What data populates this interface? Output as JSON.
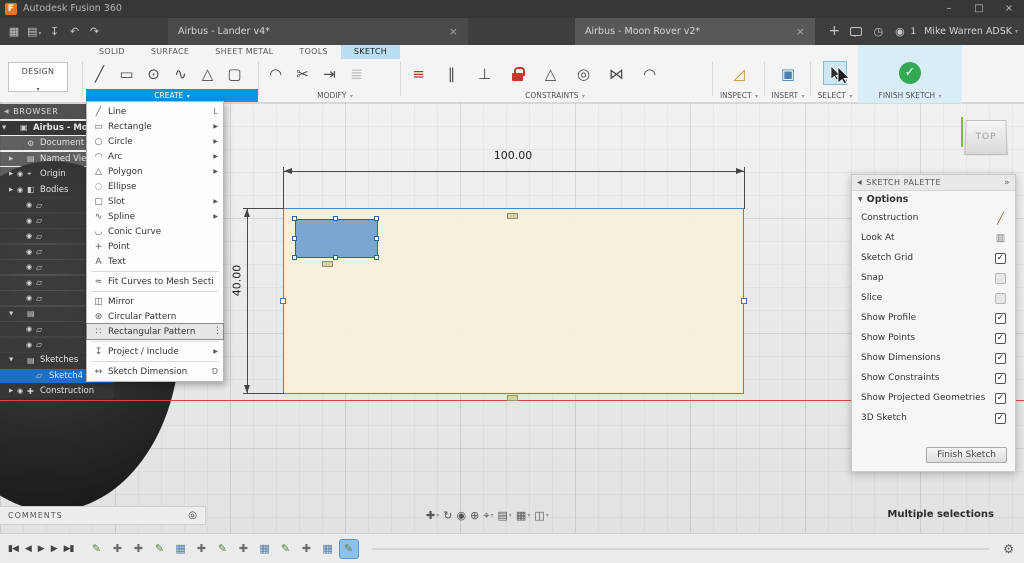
{
  "colors": {
    "accent_blue": "#0a96d7",
    "ribbon_tab_highlight": "#b9e0f1",
    "selection_blue": "#1d6fc2",
    "finish_green": "#35a854",
    "axis_red": "#c94f43",
    "profile_fill": "#f7f0db",
    "selected_geometry": "#5c92d0"
  },
  "titlebar": {
    "app_title": "Autodesk Fusion 360"
  },
  "tabbar": {
    "left_icons": [
      {
        "name": "app-grid-icon",
        "glyph": "▦"
      },
      {
        "name": "file-menu-icon",
        "glyph": "▤",
        "caret": true
      },
      {
        "name": "save-icon",
        "glyph": "↧"
      },
      {
        "name": "undo-icon",
        "glyph": "↶"
      },
      {
        "name": "redo-icon",
        "glyph": "↷"
      }
    ],
    "tabs": [
      {
        "label": "Airbus - Lander v4*"
      },
      {
        "label": "Airbus - Moon Rover v2*",
        "active": true
      }
    ],
    "notification_count": "1",
    "user_name": "Mike Warren ADSK"
  },
  "workspace": {
    "selector_label": "DESIGN"
  },
  "ribbon_tabs": [
    {
      "label": "SOLID"
    },
    {
      "label": "SURFACE"
    },
    {
      "label": "SHEET METAL"
    },
    {
      "label": "TOOLS"
    },
    {
      "label": "SKETCH",
      "active": true
    }
  ],
  "toolbar": {
    "groups": {
      "create": "CREATE",
      "modify": "MODIFY",
      "constraints": "CONSTRAINTS",
      "inspect": "INSPECT",
      "insert": "INSERT",
      "select": "SELECT",
      "finish": "FINISH SKETCH"
    },
    "create_icons": [
      {
        "name": "line-icon",
        "glyph": "╱"
      },
      {
        "name": "rectangle-icon",
        "glyph": "▭"
      },
      {
        "name": "circle-icon",
        "glyph": "⊙"
      },
      {
        "name": "spline-icon",
        "glyph": "∿"
      },
      {
        "name": "polygon-icon",
        "glyph": "△"
      },
      {
        "name": "slot-icon",
        "glyph": "▢"
      }
    ],
    "modify_icons": [
      {
        "name": "fillet-icon",
        "glyph": "◠"
      },
      {
        "name": "trim-icon",
        "glyph": "✂"
      },
      {
        "name": "extend-icon",
        "glyph": "⇥"
      },
      {
        "name": "offset-icon",
        "glyph": "≣",
        "dim": true
      }
    ],
    "constraint_icons": [
      {
        "name": "coincident-icon",
        "glyph": "≡",
        "accent": true,
        "cls": "accent-red"
      },
      {
        "name": "parallel-icon",
        "glyph": "∥"
      },
      {
        "name": "perpendicular-icon",
        "glyph": "⊥"
      },
      {
        "name": "lock-icon",
        "glyph": "",
        "cls": "lockshape"
      },
      {
        "name": "tangent-icon",
        "glyph": "△"
      },
      {
        "name": "concentric-icon",
        "glyph": "◎"
      },
      {
        "name": "symmetry-icon",
        "glyph": "⋈"
      },
      {
        "name": "curvature-icon",
        "glyph": "◠"
      }
    ]
  },
  "create_menu": {
    "items": [
      {
        "label": "Line",
        "glyph": "╱",
        "shortcut": "L"
      },
      {
        "label": "Rectangle",
        "glyph": "▭",
        "submenu": true
      },
      {
        "label": "Circle",
        "glyph": "○",
        "submenu": true
      },
      {
        "label": "Arc",
        "glyph": "◠",
        "submenu": true
      },
      {
        "label": "Polygon",
        "glyph": "△",
        "submenu": true
      },
      {
        "label": "Ellipse",
        "glyph": "◌"
      },
      {
        "label": "Slot",
        "glyph": "▢",
        "submenu": true
      },
      {
        "label": "Spline",
        "glyph": "∿",
        "submenu": true
      },
      {
        "label": "Conic Curve",
        "glyph": "◡"
      },
      {
        "label": "Point",
        "glyph": "+"
      },
      {
        "label": "Text",
        "glyph": "A"
      },
      {
        "label": "Fit Curves to Mesh Section",
        "glyph": "≈",
        "sep": true
      },
      {
        "label": "Mirror",
        "glyph": "◫",
        "sep": true
      },
      {
        "label": "Circular Pattern",
        "glyph": "⊛"
      },
      {
        "label": "Rectangular Pattern",
        "glyph": "∷",
        "highlighted": true
      },
      {
        "label": "Project / Include",
        "glyph": "↧",
        "submenu": true,
        "sep": true
      },
      {
        "label": "Sketch Dimension",
        "glyph": "↔",
        "shortcut": "D",
        "sep": true
      }
    ]
  },
  "browser": {
    "title": "BROWSER",
    "rows": [
      {
        "exp": "▼",
        "glyph": "▣",
        "label": "Airbus - Moon Ro",
        "root": true
      },
      {
        "glyph": "⚙",
        "label": "Document Settings",
        "cls": "ind1"
      },
      {
        "exp": "▶",
        "glyph": "▤",
        "label": "Named Views",
        "cls": "ind1"
      },
      {
        "exp": "▶",
        "eye": true,
        "glyph": "⌖",
        "label": "Origin",
        "cls": "ind1"
      },
      {
        "exp": "▶",
        "eye": true,
        "glyph": "◧",
        "label": "Bodies",
        "cls": "ind1"
      },
      {
        "eye": true,
        "glyph": "▱",
        "label": "",
        "cls": "ind2"
      },
      {
        "eye": true,
        "glyph": "▱",
        "label": "",
        "cls": "ind2"
      },
      {
        "eye": true,
        "glyph": "▱",
        "label": "",
        "cls": "ind2"
      },
      {
        "eye": true,
        "glyph": "▱",
        "label": "",
        "cls": "ind2"
      },
      {
        "eye": true,
        "glyph": "▱",
        "label": "",
        "cls": "ind2"
      },
      {
        "eye": true,
        "glyph": "▱",
        "label": "",
        "cls": "ind2"
      },
      {
        "eye": true,
        "glyph": "▱",
        "label": "",
        "cls": "ind2"
      },
      {
        "exp": "▼",
        "glyph": "▤",
        "label": "",
        "cls": "ind1"
      },
      {
        "eye": true,
        "glyph": "▱",
        "label": "",
        "cls": "ind2"
      },
      {
        "eye": true,
        "glyph": "▱",
        "label": "",
        "cls": "ind2"
      },
      {
        "exp": "▼",
        "glyph": "▤",
        "label": "Sketches",
        "cls": "ind1"
      },
      {
        "glyph": "▱",
        "label": "Sketch4",
        "cls": "ind2",
        "selected": true
      },
      {
        "exp": "▶",
        "eye": true,
        "glyph": "✚",
        "label": "Construction",
        "cls": "ind1"
      }
    ]
  },
  "canvas": {
    "dim_width": "100.00",
    "dim_height": "40.00",
    "viewcube_face": "TOP"
  },
  "sketch_palette": {
    "title": "SKETCH PALETTE",
    "section_label": "Options",
    "rows": [
      {
        "label": "Construction",
        "cls": "ctl-construction"
      },
      {
        "label": "Look At",
        "cls": "ctl-lookat"
      },
      {
        "label": "Sketch Grid",
        "checked": true
      },
      {
        "label": "Snap"
      },
      {
        "label": "Slice"
      },
      {
        "label": "Show Profile",
        "checked": true
      },
      {
        "label": "Show Points",
        "checked": true
      },
      {
        "label": "Show Dimensions",
        "checked": true
      },
      {
        "label": "Show Constraints",
        "checked": true
      },
      {
        "label": "Show Projected Geometries",
        "checked": true
      },
      {
        "label": "3D Sketch",
        "checked": true
      }
    ],
    "finish_button_label": "Finish Sketch"
  },
  "statusbar": {
    "comments_label": "COMMENTS",
    "selection_status": "Multiple selections"
  },
  "nav_icons": [
    {
      "name": "pan-icon",
      "glyph": "✚",
      "caret": true
    },
    {
      "name": "orbit-icon",
      "glyph": "↻"
    },
    {
      "name": "look-at-icon",
      "glyph": "◉"
    },
    {
      "name": "zoom-icon",
      "glyph": "⊕"
    },
    {
      "name": "fit-view-icon",
      "glyph": "⌖",
      "caret": true
    },
    {
      "name": "display-settings-icon",
      "glyph": "▤",
      "caret": true
    },
    {
      "name": "grid-settings-icon",
      "glyph": "▦",
      "caret": true
    },
    {
      "name": "viewports-icon",
      "glyph": "◫",
      "caret": true
    }
  ],
  "timeline": {
    "playback": [
      {
        "name": "go-to-start-icon",
        "glyph": "▮◀"
      },
      {
        "name": "step-back-icon",
        "glyph": "◀"
      },
      {
        "name": "play-icon",
        "glyph": "▶"
      },
      {
        "name": "step-forward-icon",
        "glyph": "▶"
      },
      {
        "name": "go-to-end-icon",
        "glyph": "▶▮"
      }
    ],
    "icons": [
      {
        "name": "timeline-sketch-feature",
        "glyph": "✎",
        "cls": "t-green"
      },
      {
        "name": "timeline-move-feature",
        "glyph": "✚",
        "cls": "t-gray"
      },
      {
        "name": "timeline-move-feature",
        "glyph": "✚",
        "cls": "t-gray"
      },
      {
        "name": "timeline-sketch-feature",
        "glyph": "✎",
        "cls": "t-green"
      },
      {
        "name": "timeline-pattern-feature",
        "glyph": "▦",
        "cls": "t-blue"
      },
      {
        "name": "timeline-move-feature",
        "glyph": "✚",
        "cls": "t-gray"
      },
      {
        "name": "timeline-sketch-feature",
        "glyph": "✎",
        "cls": "t-green"
      },
      {
        "name": "timeline-move-feature",
        "glyph": "✚",
        "cls": "t-gray"
      },
      {
        "name": "timeline-pattern-feature",
        "glyph": "▦",
        "cls": "t-blue"
      },
      {
        "name": "timeline-sketch-feature",
        "glyph": "✎",
        "cls": "t-green"
      },
      {
        "name": "timeline-move-feature",
        "glyph": "✚",
        "cls": "t-gray"
      },
      {
        "name": "timeline-pattern-feature",
        "glyph": "▦",
        "cls": "t-blue"
      },
      {
        "name": "timeline-active-sketch",
        "glyph": "✎",
        "cls": "t-green",
        "active": true
      }
    ]
  }
}
